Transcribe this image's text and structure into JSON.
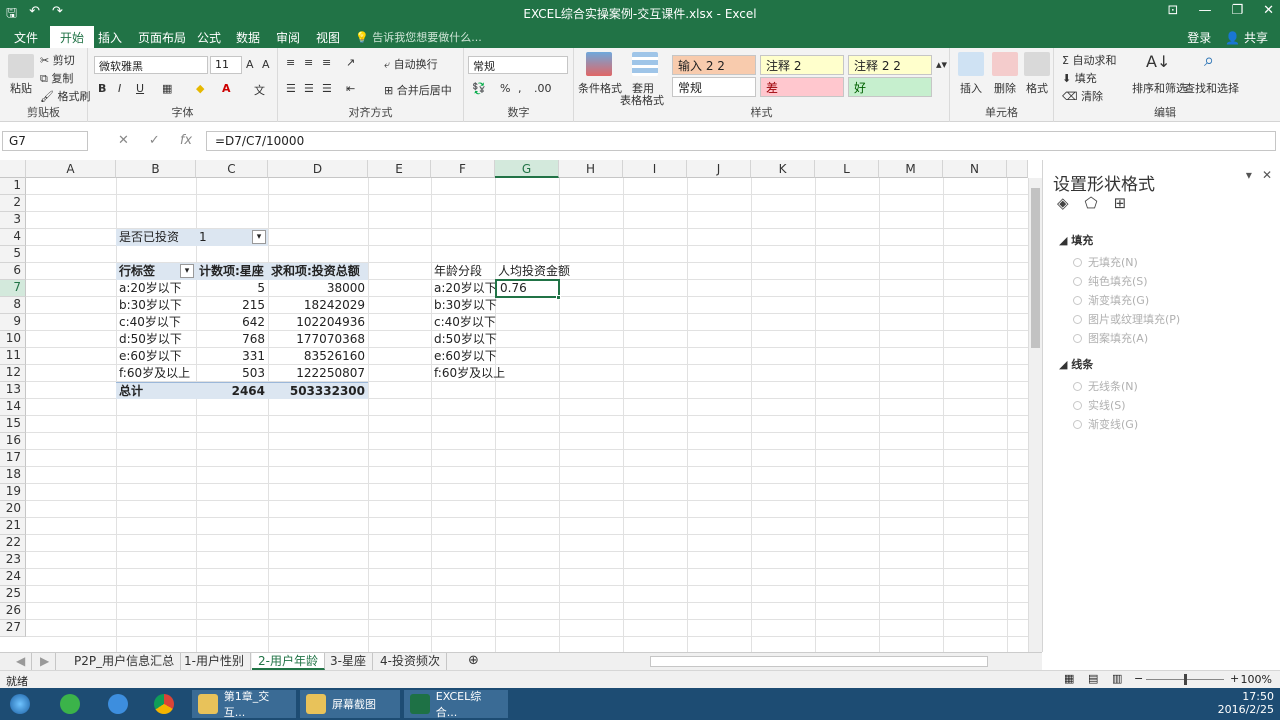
{
  "window": {
    "title": "EXCEL综合实操案例-交互课件.xlsx - Excel",
    "qat_save": "🖫",
    "qat_undo": "↶",
    "qat_redo": "↷",
    "min": "—",
    "restore": "❐",
    "close": "✕",
    "opts": "⊡"
  },
  "tabs": [
    "文件",
    "开始",
    "插入",
    "页面布局",
    "公式",
    "数据",
    "审阅",
    "视图"
  ],
  "tell_me": "告诉我您想要做什么...",
  "account": {
    "login": "登录",
    "share": "共享"
  },
  "ribbon": {
    "clipboard": {
      "paste": "粘贴",
      "cut": "剪切",
      "copy": "复制",
      "format_painter": "格式刷",
      "label": "剪贴板"
    },
    "font": {
      "name": "微软雅黑",
      "size": "11",
      "label": "字体",
      "bold": "B",
      "italic": "I",
      "underline": "U"
    },
    "align": {
      "wrap": "自动换行",
      "merge": "合并后居中",
      "label": "对齐方式"
    },
    "number": {
      "format": "常规",
      "percent": "%",
      "comma": ",",
      "label": "数字"
    },
    "styles": {
      "cond_format": "条件格式",
      "table_format_1": "套用",
      "table_format_2": "表格格式",
      "cells": [
        {
          "label": "输入 2 2",
          "bg": "#f8cbad"
        },
        {
          "label": "注释 2",
          "bg": "#ffffcc"
        },
        {
          "label": "注释 2 2",
          "bg": "#ffffcc"
        },
        {
          "label": "常规",
          "bg": "#ffffff"
        },
        {
          "label": "差",
          "bg": "#ffc7ce"
        },
        {
          "label": "好",
          "bg": "#c6efce"
        }
      ],
      "label": "样式"
    },
    "cells": {
      "insert": "插入",
      "delete": "删除",
      "format": "格式",
      "label": "单元格"
    },
    "editing": {
      "autosum": "自动求和",
      "fill": "填充",
      "clear": "清除",
      "sort": "排序和筛选",
      "find": "查找和选择",
      "label": "编辑"
    }
  },
  "formula_bar": {
    "name_box": "G7",
    "formula": "=D7/C7/10000"
  },
  "columns": [
    "A",
    "B",
    "C",
    "D",
    "E",
    "F",
    "G",
    "H",
    "I",
    "J",
    "K",
    "L",
    "M",
    "N"
  ],
  "rows": [
    "1",
    "2",
    "3",
    "4",
    "5",
    "6",
    "7",
    "8",
    "9",
    "10",
    "11",
    "12",
    "13",
    "14",
    "15",
    "16",
    "17",
    "18",
    "19",
    "20",
    "21",
    "22",
    "23",
    "24",
    "25",
    "26",
    "27"
  ],
  "pivot": {
    "filter_label": "是否已投资",
    "filter_value": "1",
    "headers": [
      "行标签",
      "计数项:星座",
      "求和项:投资总额"
    ],
    "rows": [
      {
        "label": "a:20岁以下",
        "count": "5",
        "sum": "38000"
      },
      {
        "label": "b:30岁以下",
        "count": "215",
        "sum": "18242029"
      },
      {
        "label": "c:40岁以下",
        "count": "642",
        "sum": "102204936"
      },
      {
        "label": "d:50岁以下",
        "count": "768",
        "sum": "177070368"
      },
      {
        "label": "e:60岁以下",
        "count": "331",
        "sum": "83526160"
      },
      {
        "label": "f:60岁及以上",
        "count": "503",
        "sum": "122250807"
      }
    ],
    "total": {
      "label": "总计",
      "count": "2464",
      "sum": "503332300"
    }
  },
  "side_table": {
    "header_f": "年龄分段",
    "header_g": "人均投资金额",
    "rows": [
      "a:20岁以下",
      "b:30岁以下",
      "c:40岁以下",
      "d:50岁以下",
      "e:60岁以下",
      "f:60岁及以上"
    ],
    "g7": "0.76"
  },
  "pane": {
    "title": "设置形状格式",
    "fill_section": "填充",
    "fill_options": [
      "无填充(N)",
      "纯色填充(S)",
      "渐变填充(G)",
      "图片或纹理填充(P)",
      "图案填充(A)"
    ],
    "line_section": "线条",
    "line_options": [
      "无线条(N)",
      "实线(S)",
      "渐变线(G)"
    ]
  },
  "sheet_tabs": [
    "P2P_用户信息汇总",
    "1-用户性别",
    "2-用户年龄",
    "3-星座",
    "4-投资频次"
  ],
  "status": {
    "ready": "就绪",
    "zoom": "100%"
  },
  "taskbar": {
    "apps": [
      "第1章_交互...",
      "屏幕截图",
      "EXCEL综合..."
    ],
    "time": "17:50",
    "date": "2016/2/25"
  }
}
